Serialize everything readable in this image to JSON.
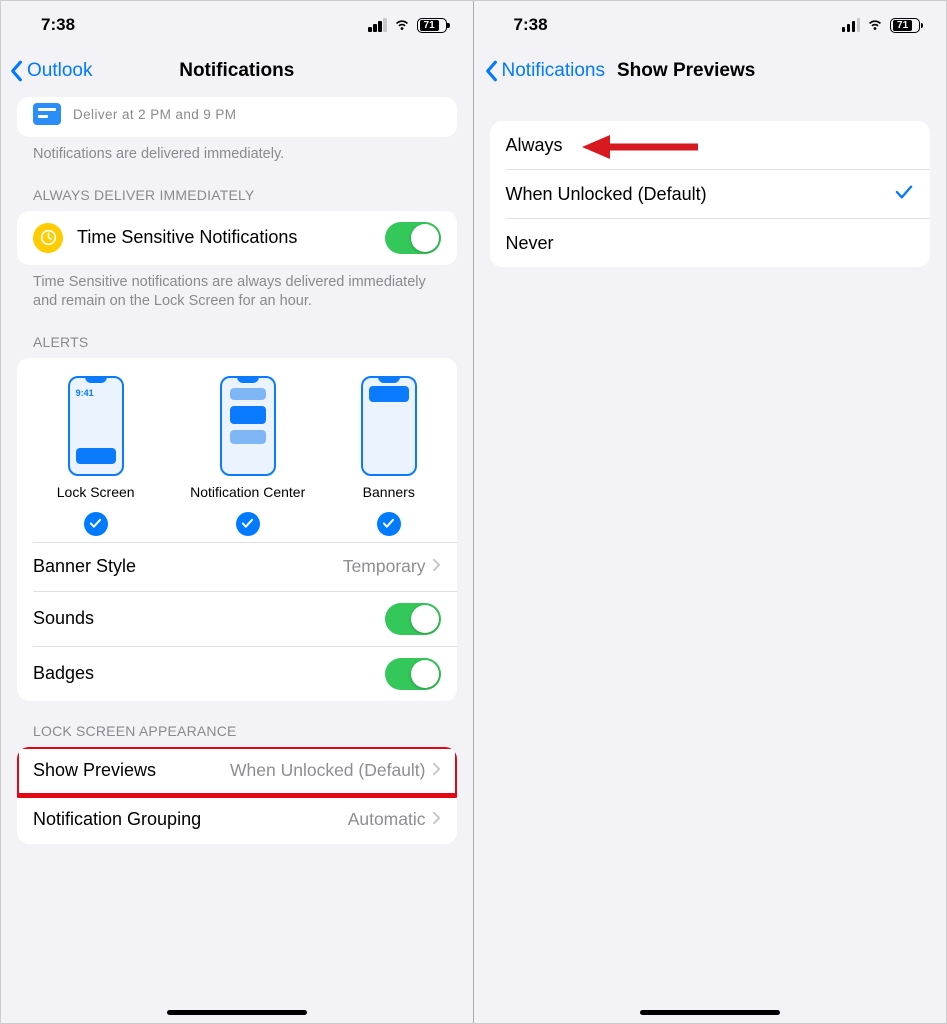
{
  "left": {
    "status_time": "7:38",
    "battery": "71",
    "back_label": "Outlook",
    "title": "Notifications",
    "deliver_sub": "Deliver at 2 PM and 9 PM",
    "delivered_footer": "Notifications are delivered immediately.",
    "section_always": "ALWAYS DELIVER IMMEDIATELY",
    "time_sensitive_label": "Time Sensitive Notifications",
    "time_sensitive_footer": "Time Sensitive notifications are always delivered immediately and remain on the Lock Screen for an hour.",
    "section_alerts": "ALERTS",
    "alert_opts": {
      "lock": "Lock Screen",
      "nc": "Notification Center",
      "banners": "Banners",
      "mock_time": "9:41"
    },
    "banner_style_label": "Banner Style",
    "banner_style_value": "Temporary",
    "sounds_label": "Sounds",
    "badges_label": "Badges",
    "section_lock": "LOCK SCREEN APPEARANCE",
    "show_previews_label": "Show Previews",
    "show_previews_value": "When Unlocked (Default)",
    "grouping_label": "Notification Grouping",
    "grouping_value": "Automatic"
  },
  "right": {
    "status_time": "7:38",
    "battery": "71",
    "back_label": "Notifications",
    "title": "Show Previews",
    "options": {
      "always": "Always",
      "when_unlocked": "When Unlocked (Default)",
      "never": "Never"
    }
  }
}
